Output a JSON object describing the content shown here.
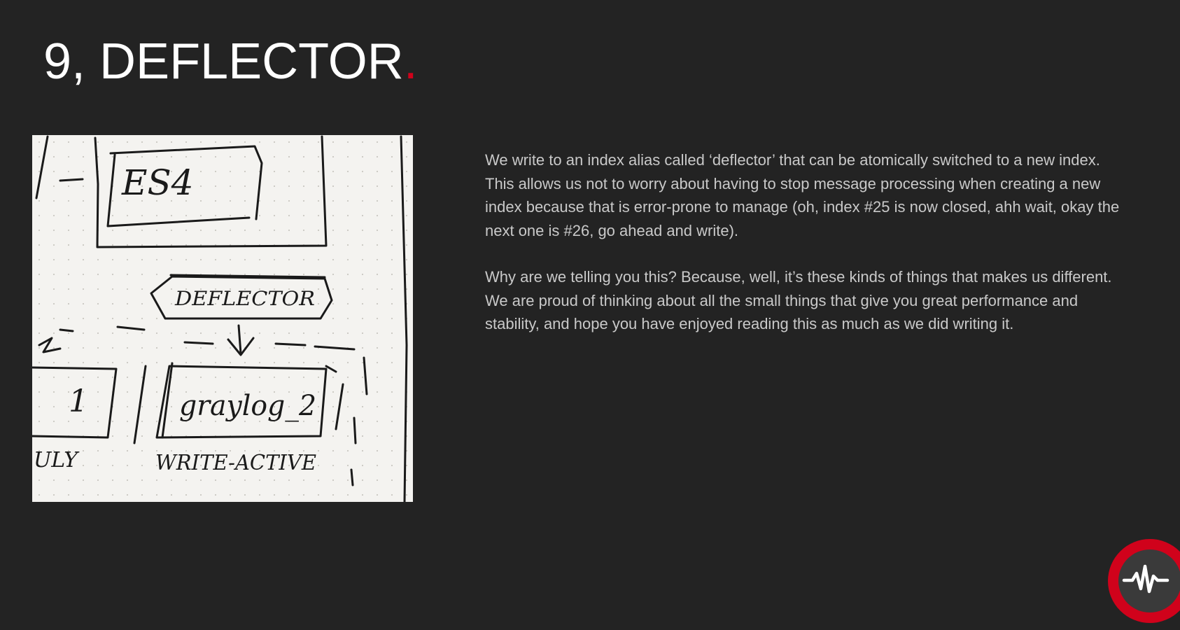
{
  "slide": {
    "title_main": "9, DEFLECTOR",
    "title_dot": "."
  },
  "sketch": {
    "labels": {
      "es": "ES4",
      "deflector": "DEFLECTOR",
      "index_left": "1",
      "index_right": "graylog_2",
      "status_left": "ULY",
      "status_right": "WRITE-ACTIVE"
    }
  },
  "content": {
    "paragraph_1": "We write to an index alias called ‘deflector’ that can be atomically switched to a new index. This allows us not to worry about having to stop message processing when creating a new index because that is error-prone to manage (oh, index #25 is now closed, ahh wait, okay the next one is #26, go ahead and write).",
    "paragraph_2": "Why are we telling you this?  Because, well, it’s these kinds of things that makes us different.  We are proud of thinking about all the small things that give you great performance and stability, and hope you have enjoyed reading this as much as we did writing it."
  },
  "colors": {
    "background": "#232323",
    "title": "#ffffff",
    "accent": "#d0021b",
    "body_text": "#c9c9c9",
    "paper": "#f4f3f0"
  },
  "icons": {
    "logo": "graylog-pulse-logo-icon"
  }
}
